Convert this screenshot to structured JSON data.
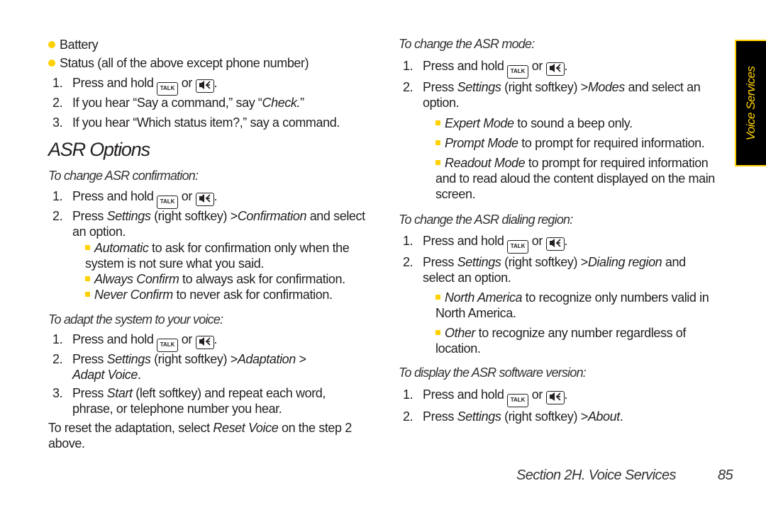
{
  "tab": {
    "label": "Voice Services",
    "colors": {
      "bg": "#000000",
      "accent": "#ffd100"
    }
  },
  "keys": {
    "talk": "TALK",
    "speaker": "speaker-key"
  },
  "left": {
    "bullets": [
      "Battery",
      "Status (all of the above except phone number)"
    ],
    "status_steps": [
      {
        "num": "1.",
        "pre": "Press and hold",
        "mid": "or",
        "post": "."
      },
      {
        "num": "2.",
        "text_pre": "If you hear “Say a command,” say “",
        "em": "Check.",
        "text_post": "”"
      },
      {
        "num": "3.",
        "text": "If you hear “Which status item?,” say a command."
      }
    ],
    "heading": "ASR Options",
    "confirm": {
      "subhead": "To change ASR confirmation:",
      "step1": {
        "num": "1.",
        "pre": "Press and hold",
        "mid": "or",
        "post": "."
      },
      "step2": {
        "num": "2.",
        "pre": "Press",
        "em1": "Settings",
        "mid": "(right softkey) >",
        "em2": "Confirmation",
        "post": "and select an option."
      },
      "options": [
        {
          "em": "Automatic",
          "text": "to ask for confirmation only when the system is not sure what you said."
        },
        {
          "em": "Always Confirm",
          "text": "to always ask for confirmation."
        },
        {
          "em": "Never Confirm",
          "text": "to never ask for confirmation."
        }
      ]
    },
    "adapt": {
      "subhead": "To adapt the system to your voice:",
      "step1": {
        "num": "1.",
        "pre": "Press and hold",
        "mid": "or",
        "post": "."
      },
      "step2": {
        "num": "2.",
        "pre": "Press",
        "em1": "Settings",
        "mid": "(right softkey) >",
        "em2": "Adaptation",
        "sep": ">",
        "em3": "Adapt Voice",
        "post": "."
      },
      "step3": {
        "num": "3.",
        "pre": "Press",
        "em": "Start",
        "post": "(left softkey) and repeat each word, phrase, or telephone number you hear."
      },
      "note": {
        "pre": "To reset the adaptation, select",
        "em": "Reset Voice",
        "post": "on the step 2 above."
      }
    }
  },
  "right": {
    "mode": {
      "subhead": "To change the ASR mode:",
      "step1": {
        "num": "1.",
        "pre": "Press and hold",
        "mid": "or",
        "post": "."
      },
      "step2": {
        "num": "2.",
        "pre": "Press",
        "em1": "Settings",
        "mid": "(right softkey) >",
        "em2": "Modes",
        "post": "and select an option."
      },
      "options": [
        {
          "em": "Expert Mode",
          "text": "to sound a beep only."
        },
        {
          "em": "Prompt Mode",
          "text": "to prompt for required information."
        },
        {
          "em": "Readout Mode",
          "text": "to prompt for required information and to read aloud the content displayed on the main screen."
        }
      ]
    },
    "region": {
      "subhead": "To change the ASR dialing region:",
      "step1": {
        "num": "1.",
        "pre": "Press and hold",
        "mid": "or",
        "post": "."
      },
      "step2": {
        "num": "2.",
        "pre": "Press",
        "em1": "Settings",
        "mid": "(right softkey) >",
        "em2": "Dialing region",
        "post": "and select an option."
      },
      "options": [
        {
          "em": "North America",
          "text": "to recognize only numbers valid in North America."
        },
        {
          "em": "Other",
          "text": "to recognize any number regardless of location."
        }
      ]
    },
    "version": {
      "subhead": "To display the ASR software version:",
      "step1": {
        "num": "1.",
        "pre": "Press and hold",
        "mid": "or",
        "post": "."
      },
      "step2": {
        "num": "2.",
        "pre": "Press",
        "em1": "Settings",
        "mid": "(right softkey) >",
        "em2": "About",
        "post": "."
      }
    }
  },
  "footer": {
    "section": "Section 2H. Voice Services",
    "page": "85"
  }
}
